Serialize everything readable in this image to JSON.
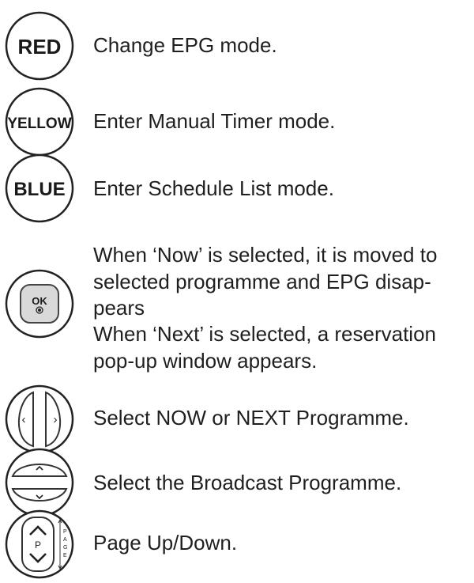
{
  "buttons": {
    "red": "RED",
    "yellow": "YELLOW",
    "blue": "BLUE",
    "ok": "OK",
    "p": "P",
    "page": "PAGE"
  },
  "rows": {
    "red": "Change EPG mode.",
    "yellow": "Enter Manual Timer mode.",
    "blue": "Enter Schedule List mode.",
    "ok_line1": "When ‘Now’ is selected, it is moved to",
    "ok_line2": "selected programme and EPG disap-",
    "ok_line3": "pears",
    "ok_line4": "When ‘Next’ is selected, a reservation",
    "ok_line5": "pop-up window appears.",
    "leftright": "Select NOW or NEXT Programme.",
    "updown": "Select the Broadcast Programme.",
    "page": "Page Up/Down."
  }
}
